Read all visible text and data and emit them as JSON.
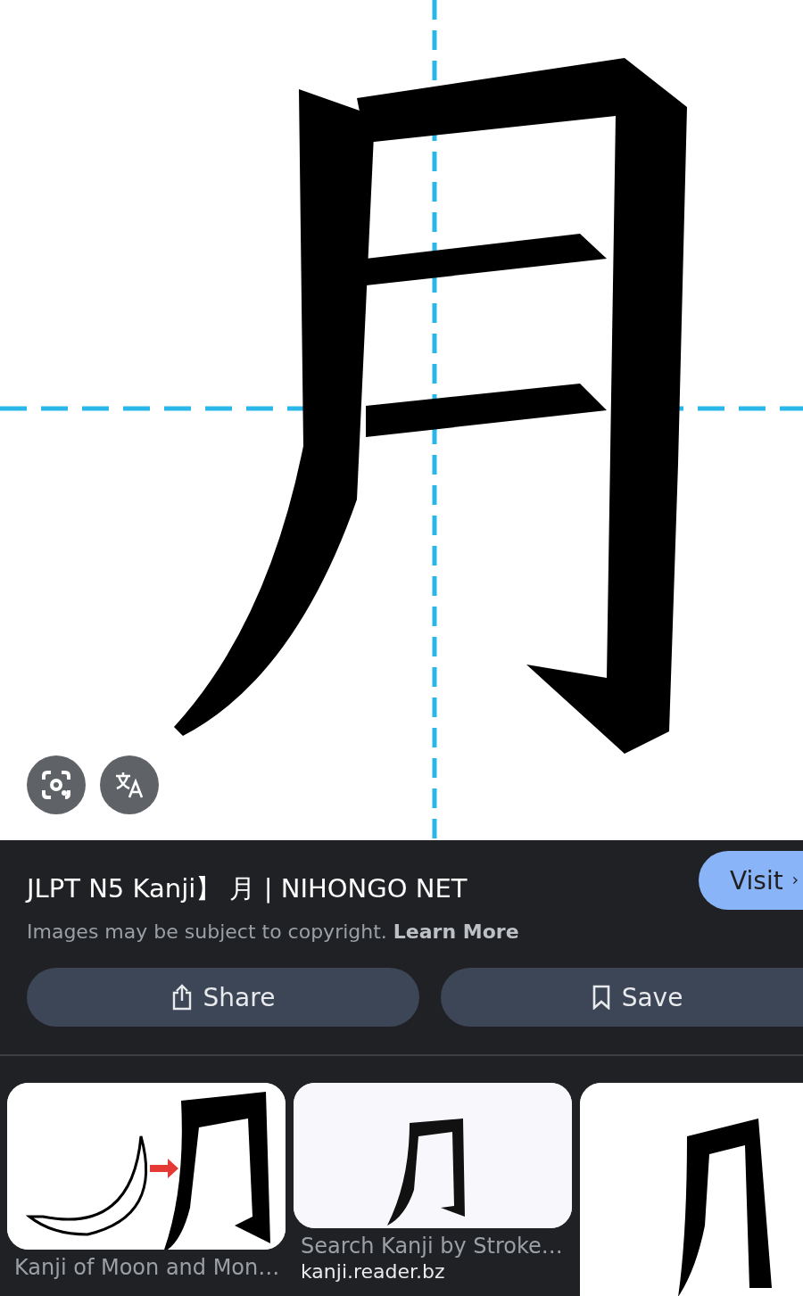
{
  "image_viewer": {
    "main_image": {
      "kind": "picture"
    },
    "overlay_buttons": [
      {
        "kind": "lens"
      },
      {
        "kind": "translate"
      }
    ]
  },
  "info": {
    "title": "JLPT N5 Kanji】 月 | NIHONGO NET",
    "visit_button": "Visit",
    "notice": "Images may be subject to copyright. **Learn More**",
    "actions": [
      {
        "kind": "share",
        "label": "Share"
      },
      {
        "kind": "save",
        "label": "Save"
      }
    ]
  },
  "related": [
    {
      "kind": "picture",
      "title": "Kanji of Moon and Mon…"
    },
    {
      "kind": "picture",
      "title": "Search Kanji by Stroke…",
      "source": "kanji.reader.bz"
    },
    {
      "kind": "picture"
    }
  ]
}
